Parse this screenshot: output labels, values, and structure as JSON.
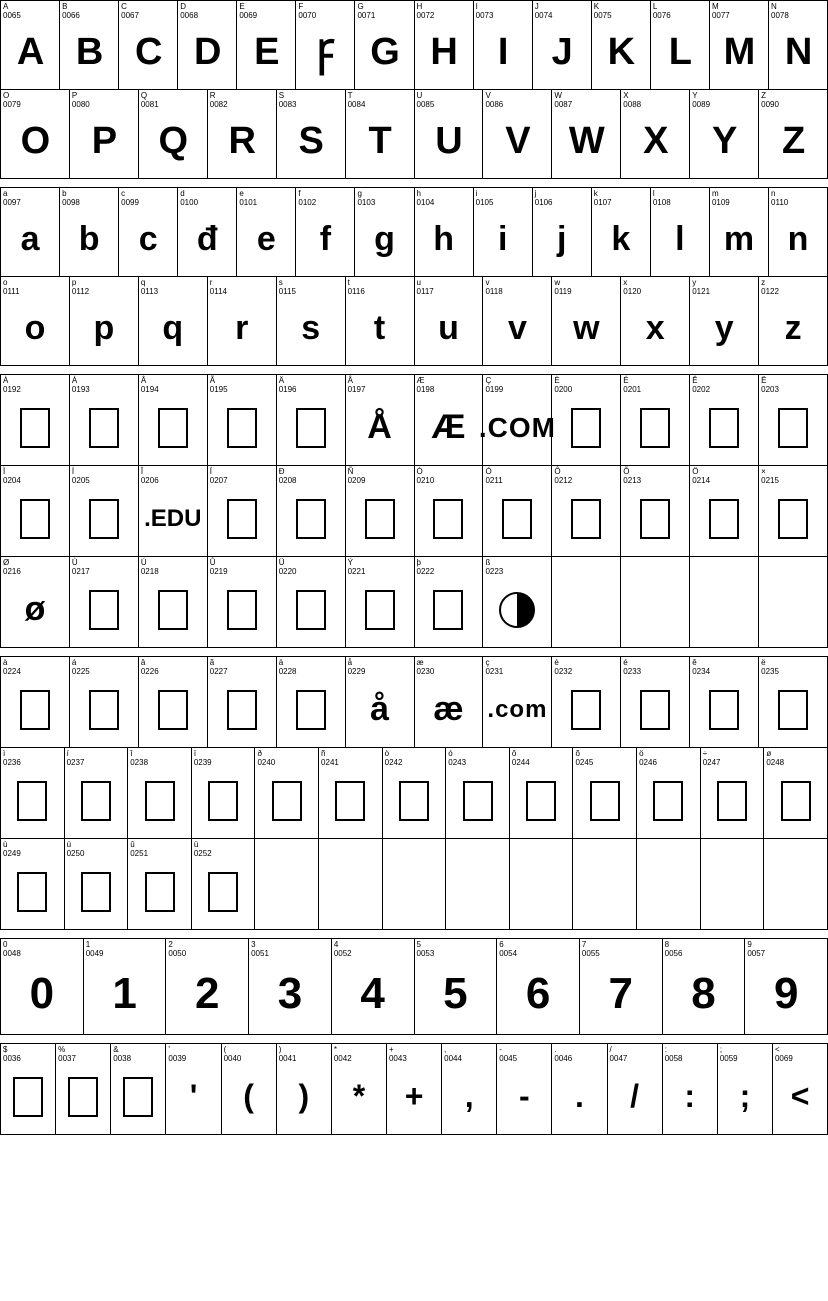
{
  "sections": [
    {
      "id": "uppercase-row1",
      "class": "row-uppercase",
      "cells": [
        {
          "code": "0065",
          "label": "A",
          "char": "A",
          "type": "letter"
        },
        {
          "code": "0066",
          "label": "B",
          "char": "B",
          "type": "letter"
        },
        {
          "code": "0067",
          "label": "C",
          "char": "C",
          "type": "letter"
        },
        {
          "code": "0068",
          "label": "D",
          "char": "D",
          "type": "letter"
        },
        {
          "code": "0069",
          "label": "E",
          "char": "E",
          "type": "letter"
        },
        {
          "code": "0070",
          "label": "F",
          "char": "Ꝼ",
          "type": "letter"
        },
        {
          "code": "0071",
          "label": "G",
          "char": "G",
          "type": "letter"
        },
        {
          "code": "0072",
          "label": "H",
          "char": "H",
          "type": "letter"
        },
        {
          "code": "0073",
          "label": "I",
          "char": "I",
          "type": "letter"
        },
        {
          "code": "0074",
          "label": "J",
          "char": "J",
          "type": "letter"
        },
        {
          "code": "0075",
          "label": "K",
          "char": "K",
          "type": "letter"
        },
        {
          "code": "0076",
          "label": "L",
          "char": "L",
          "type": "letter"
        },
        {
          "code": "0077",
          "label": "M",
          "char": "M",
          "type": "letter"
        },
        {
          "code": "0078",
          "label": "N",
          "char": "N",
          "type": "letter"
        }
      ]
    },
    {
      "id": "uppercase-row2",
      "class": "row-uppercase2",
      "cells": [
        {
          "code": "0079",
          "label": "O",
          "char": "O",
          "type": "letter"
        },
        {
          "code": "0080",
          "label": "P",
          "char": "P",
          "type": "letter"
        },
        {
          "code": "0081",
          "label": "Q",
          "char": "Q",
          "type": "letter"
        },
        {
          "code": "0082",
          "label": "R",
          "char": "R",
          "type": "letter"
        },
        {
          "code": "0083",
          "label": "S",
          "char": "S",
          "type": "letter"
        },
        {
          "code": "0084",
          "label": "T",
          "char": "T",
          "type": "letter"
        },
        {
          "code": "0085",
          "label": "U",
          "char": "U",
          "type": "letter"
        },
        {
          "code": "0086",
          "label": "V",
          "char": "V",
          "type": "letter"
        },
        {
          "code": "0087",
          "label": "W",
          "char": "W",
          "type": "letter"
        },
        {
          "code": "0088",
          "label": "X",
          "char": "X",
          "type": "letter"
        },
        {
          "code": "0089",
          "label": "Y",
          "char": "Y",
          "type": "letter"
        },
        {
          "code": "0090",
          "label": "Z",
          "char": "Z",
          "type": "letter"
        }
      ]
    },
    {
      "id": "lowercase-row1",
      "class": "row-lowercase",
      "cells": [
        {
          "code": "0097",
          "label": "a",
          "char": "a",
          "type": "lc"
        },
        {
          "code": "0098",
          "label": "b",
          "char": "b",
          "type": "lc"
        },
        {
          "code": "0099",
          "label": "c",
          "char": "c",
          "type": "lc"
        },
        {
          "code": "0100",
          "label": "d",
          "char": "đ",
          "type": "lc"
        },
        {
          "code": "0101",
          "label": "e",
          "char": "e",
          "type": "lc"
        },
        {
          "code": "0102",
          "label": "f",
          "char": "f",
          "type": "lc"
        },
        {
          "code": "0103",
          "label": "g",
          "char": "g",
          "type": "lc"
        },
        {
          "code": "0104",
          "label": "h",
          "char": "h",
          "type": "lc"
        },
        {
          "code": "0105",
          "label": "i",
          "char": "i",
          "type": "lc"
        },
        {
          "code": "0106",
          "label": "j",
          "char": "j",
          "type": "lc"
        },
        {
          "code": "0107",
          "label": "k",
          "char": "k",
          "type": "lc"
        },
        {
          "code": "0108",
          "label": "l",
          "char": "l",
          "type": "lc"
        },
        {
          "code": "0109",
          "label": "m",
          "char": "m",
          "type": "lc"
        },
        {
          "code": "0110",
          "label": "n",
          "char": "n",
          "type": "lc"
        }
      ]
    },
    {
      "id": "lowercase-row2",
      "class": "row-lowercase2",
      "cells": [
        {
          "code": "0111",
          "label": "o",
          "char": "o",
          "type": "lc"
        },
        {
          "code": "0112",
          "label": "p",
          "char": "p",
          "type": "lc"
        },
        {
          "code": "0113",
          "label": "q",
          "char": "q",
          "type": "lc"
        },
        {
          "code": "0114",
          "label": "r",
          "char": "r",
          "type": "lc"
        },
        {
          "code": "0115",
          "label": "s",
          "char": "s",
          "type": "lc"
        },
        {
          "code": "0116",
          "label": "t",
          "char": "t",
          "type": "lc"
        },
        {
          "code": "0117",
          "label": "u",
          "char": "u",
          "type": "lc"
        },
        {
          "code": "0118",
          "label": "v",
          "char": "v",
          "type": "lc"
        },
        {
          "code": "0119",
          "label": "w",
          "char": "w",
          "type": "lc"
        },
        {
          "code": "0120",
          "label": "x",
          "char": "x",
          "type": "lc"
        },
        {
          "code": "0121",
          "label": "y",
          "char": "y",
          "type": "lc"
        },
        {
          "code": "0122",
          "label": "z",
          "char": "z",
          "type": "lc"
        }
      ]
    },
    {
      "id": "special1-row1",
      "class": "row-special1",
      "cells": [
        {
          "code": "0192",
          "label": "À",
          "char": "□",
          "type": "box"
        },
        {
          "code": "0193",
          "label": "Á",
          "char": "□",
          "type": "box"
        },
        {
          "code": "0194",
          "label": "Â",
          "char": "□",
          "type": "box"
        },
        {
          "code": "0195",
          "label": "Ã",
          "char": "□",
          "type": "box"
        },
        {
          "code": "0196",
          "label": "Ä",
          "char": "□",
          "type": "box"
        },
        {
          "code": "0197",
          "label": "Å",
          "char": "Å",
          "type": "special"
        },
        {
          "code": "0198",
          "label": "Æ",
          "char": "Æ",
          "type": "special"
        },
        {
          "code": "0199",
          "label": "Ç",
          "char": ".COM",
          "type": "com"
        },
        {
          "code": "0200",
          "label": "È",
          "char": "□",
          "type": "box"
        },
        {
          "code": "0201",
          "label": "É",
          "char": "□",
          "type": "box"
        },
        {
          "code": "0202",
          "label": "Ê",
          "char": "□",
          "type": "box"
        },
        {
          "code": "0203",
          "label": "Ë",
          "char": "□",
          "type": "box"
        }
      ]
    },
    {
      "id": "special1-row2",
      "class": "row-special2",
      "cells": [
        {
          "code": "0204",
          "label": "Ì",
          "char": "□",
          "type": "box"
        },
        {
          "code": "0205",
          "label": "Í",
          "char": "□",
          "type": "box"
        },
        {
          "code": "0206",
          "label": "Î",
          "char": ".EDU",
          "type": "edu"
        },
        {
          "code": "0207",
          "label": "Ï",
          "char": "□",
          "type": "box"
        },
        {
          "code": "0208",
          "label": "Ð",
          "char": "□",
          "type": "box"
        },
        {
          "code": "0209",
          "label": "Ñ",
          "char": "□",
          "type": "box"
        },
        {
          "code": "0210",
          "label": "Ò",
          "char": "□",
          "type": "box"
        },
        {
          "code": "0211",
          "label": "Ó",
          "char": "□",
          "type": "box"
        },
        {
          "code": "0212",
          "label": "Ô",
          "char": "□",
          "type": "box"
        },
        {
          "code": "0213",
          "label": "Õ",
          "char": "□",
          "type": "box"
        },
        {
          "code": "0214",
          "label": "Ö",
          "char": "□",
          "type": "box"
        },
        {
          "code": "0215",
          "label": "×",
          "char": "□",
          "type": "box"
        }
      ]
    },
    {
      "id": "special1-row3",
      "class": "row-special3",
      "cells": [
        {
          "code": "0216",
          "label": "Ø",
          "char": "ø",
          "type": "lc"
        },
        {
          "code": "0217",
          "label": "Ù",
          "char": "□",
          "type": "box"
        },
        {
          "code": "0218",
          "label": "Ú",
          "char": "□",
          "type": "box"
        },
        {
          "code": "0219",
          "label": "Û",
          "char": "□",
          "type": "box"
        },
        {
          "code": "0220",
          "label": "Ü",
          "char": "□",
          "type": "box"
        },
        {
          "code": "0221",
          "label": "Ý",
          "char": "□",
          "type": "box"
        },
        {
          "code": "0222",
          "label": "þ",
          "char": "□",
          "type": "box"
        },
        {
          "code": "0223",
          "label": "ß",
          "char": "◑",
          "type": "circle"
        },
        {
          "code": null,
          "label": "",
          "char": "",
          "type": "empty"
        },
        {
          "code": null,
          "label": "",
          "char": "",
          "type": "empty"
        },
        {
          "code": null,
          "label": "",
          "char": "",
          "type": "empty"
        },
        {
          "code": null,
          "label": "",
          "char": "",
          "type": "empty"
        }
      ]
    },
    {
      "id": "special-lc-row1",
      "class": "row-special-lc1",
      "cells": [
        {
          "code": "0224",
          "label": "à",
          "char": "□",
          "type": "box"
        },
        {
          "code": "0225",
          "label": "á",
          "char": "□",
          "type": "box"
        },
        {
          "code": "0226",
          "label": "â",
          "char": "□",
          "type": "box"
        },
        {
          "code": "0227",
          "label": "ã",
          "char": "□",
          "type": "box"
        },
        {
          "code": "0228",
          "label": "ä",
          "char": "□",
          "type": "box"
        },
        {
          "code": "0229",
          "label": "å",
          "char": "å",
          "type": "special"
        },
        {
          "code": "0230",
          "label": "æ",
          "char": "æ",
          "type": "special"
        },
        {
          "code": "0231",
          "label": "ç",
          "char": ".com",
          "type": "com-lc"
        },
        {
          "code": "0232",
          "label": "è",
          "char": "□",
          "type": "box"
        },
        {
          "code": "0233",
          "label": "é",
          "char": "□",
          "type": "box"
        },
        {
          "code": "0234",
          "label": "ê",
          "char": "□",
          "type": "box"
        },
        {
          "code": "0235",
          "label": "ë",
          "char": "□",
          "type": "box"
        }
      ]
    },
    {
      "id": "special-lc-row2",
      "class": "row-special-lc2",
      "cells": [
        {
          "code": "0236",
          "label": "ì",
          "char": "□",
          "type": "box"
        },
        {
          "code": "0237",
          "label": "í",
          "char": "□",
          "type": "box"
        },
        {
          "code": "0238",
          "label": "î",
          "char": "□",
          "type": "box"
        },
        {
          "code": "0239",
          "label": "ï",
          "char": "□",
          "type": "box"
        },
        {
          "code": "0240",
          "label": "ð",
          "char": "□",
          "type": "box"
        },
        {
          "code": "0241",
          "label": "ñ",
          "char": "□",
          "type": "box"
        },
        {
          "code": "0242",
          "label": "ò",
          "char": "□",
          "type": "box"
        },
        {
          "code": "0243",
          "label": "ó",
          "char": "□",
          "type": "box"
        },
        {
          "code": "0244",
          "label": "ô",
          "char": "□",
          "type": "box"
        },
        {
          "code": "0245",
          "label": "õ",
          "char": "□",
          "type": "box"
        },
        {
          "code": "0246",
          "label": "ö",
          "char": "□",
          "type": "box"
        },
        {
          "code": "0247",
          "label": "÷",
          "char": "□",
          "type": "box"
        },
        {
          "code": "0248",
          "label": "ø",
          "char": "□",
          "type": "box"
        }
      ]
    },
    {
      "id": "special-lc-row3",
      "class": "row-special-lc3",
      "cells": [
        {
          "code": "0249",
          "label": "ù",
          "char": "□",
          "type": "box"
        },
        {
          "code": "0250",
          "label": "ú",
          "char": "□",
          "type": "box"
        },
        {
          "code": "0251",
          "label": "û",
          "char": "□",
          "type": "box"
        },
        {
          "code": "0252",
          "label": "ü",
          "char": "□",
          "type": "box"
        },
        {
          "code": null,
          "label": "",
          "char": "",
          "type": "empty"
        },
        {
          "code": null,
          "label": "",
          "char": "",
          "type": "empty"
        },
        {
          "code": null,
          "label": "",
          "char": "",
          "type": "empty"
        },
        {
          "code": null,
          "label": "",
          "char": "",
          "type": "empty"
        },
        {
          "code": null,
          "label": "",
          "char": "",
          "type": "empty"
        },
        {
          "code": null,
          "label": "",
          "char": "",
          "type": "empty"
        },
        {
          "code": null,
          "label": "",
          "char": "",
          "type": "empty"
        },
        {
          "code": null,
          "label": "",
          "char": "",
          "type": "empty"
        },
        {
          "code": null,
          "label": "",
          "char": "",
          "type": "empty"
        }
      ]
    },
    {
      "id": "nums-row",
      "class": "row-nums",
      "cells": [
        {
          "code": "0048",
          "label": "0",
          "char": "0",
          "type": "num"
        },
        {
          "code": "0049",
          "label": "1",
          "char": "1",
          "type": "num"
        },
        {
          "code": "0050",
          "label": "2",
          "char": "2",
          "type": "num"
        },
        {
          "code": "0051",
          "label": "3",
          "char": "3",
          "type": "num"
        },
        {
          "code": "0052",
          "label": "4",
          "char": "4",
          "type": "num"
        },
        {
          "code": "0053",
          "label": "5",
          "char": "5",
          "type": "num"
        },
        {
          "code": "0054",
          "label": "6",
          "char": "6",
          "type": "num"
        },
        {
          "code": "0055",
          "label": "7",
          "char": "7",
          "type": "num"
        },
        {
          "code": "0056",
          "label": "8",
          "char": "8",
          "type": "num"
        },
        {
          "code": "0057",
          "label": "9",
          "char": "9",
          "type": "num"
        }
      ]
    },
    {
      "id": "punct-row",
      "class": "row-punct",
      "cells": [
        {
          "code": "0036",
          "label": "$",
          "char": "□",
          "type": "box"
        },
        {
          "code": "0037",
          "label": "%",
          "char": "□",
          "type": "box"
        },
        {
          "code": "0038",
          "label": "&",
          "char": "□",
          "type": "box"
        },
        {
          "code": "0039",
          "label": "'",
          "char": "'",
          "type": "punct"
        },
        {
          "code": "0040",
          "label": "(",
          "char": "(",
          "type": "punct"
        },
        {
          "code": "0041",
          "label": ")",
          "char": ")",
          "type": "punct"
        },
        {
          "code": "0042",
          "label": "*",
          "char": "*",
          "type": "punct"
        },
        {
          "code": "0043",
          "label": "+",
          "char": "+",
          "type": "punct"
        },
        {
          "code": "0044",
          "label": ",",
          "char": ",",
          "type": "punct"
        },
        {
          "code": "0045",
          "label": "-",
          "char": "-",
          "type": "punct"
        },
        {
          "code": "0046",
          "label": ".",
          "char": ".",
          "type": "punct"
        },
        {
          "code": "0047",
          "label": "/",
          "char": "/",
          "type": "punct"
        },
        {
          "code": "0058",
          "label": ":",
          "char": ":",
          "type": "punct"
        },
        {
          "code": "0059",
          "label": ";",
          "char": ";",
          "type": "punct"
        },
        {
          "code": "0069",
          "label": "<",
          "char": "<",
          "type": "punct"
        }
      ]
    }
  ]
}
